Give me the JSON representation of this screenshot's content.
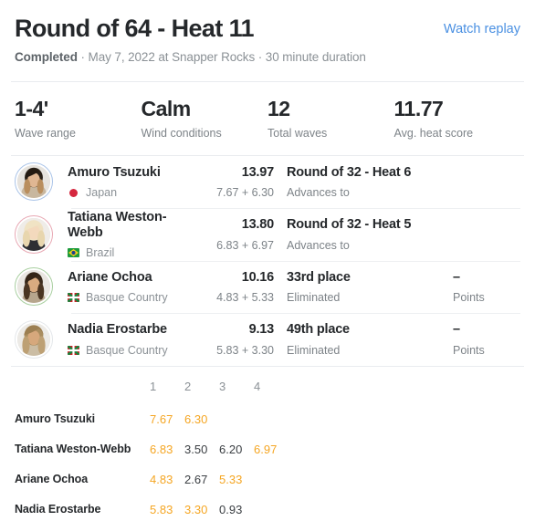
{
  "header": {
    "title": "Round of 64 - Heat 11",
    "watch_replay_label": "Watch replay",
    "status": "Completed",
    "subtitle_rest": " · May 7, 2022 at Snapper Rocks · 30 minute duration"
  },
  "stats": [
    {
      "value": "1-4'",
      "label": "Wave range"
    },
    {
      "value": "Calm",
      "label": "Wind conditions"
    },
    {
      "value": "12",
      "label": "Total waves"
    },
    {
      "value": "11.77",
      "label": "Avg. heat score"
    }
  ],
  "athletes": [
    {
      "name": "Amuro Tsuzuki",
      "country": "Japan",
      "flag": "japan-flag-icon",
      "ring_color": "#aac4e8",
      "total": "13.97",
      "breakdown": "7.67 + 6.30",
      "outcome": "Round of 32 - Heat 6",
      "outcome_sub": "Advances to",
      "points": "",
      "points_label": ""
    },
    {
      "name": "Tatiana Weston-Webb",
      "country": "Brazil",
      "flag": "brazil-flag-icon",
      "ring_color": "#e8a9b4",
      "total": "13.80",
      "breakdown": "6.83 + 6.97",
      "outcome": "Round of 32 - Heat 5",
      "outcome_sub": "Advances to",
      "points": "",
      "points_label": ""
    },
    {
      "name": "Ariane Ochoa",
      "country": "Basque Country",
      "flag": "basque-flag-icon",
      "ring_color": "#a9cfa0",
      "total": "10.16",
      "breakdown": "4.83 + 5.33",
      "outcome": "33rd place",
      "outcome_sub": "Eliminated",
      "points": "–",
      "points_label": "Points"
    },
    {
      "name": "Nadia Erostarbe",
      "country": "Basque Country",
      "flag": "basque-flag-icon",
      "ring_color": "#e4e7ea",
      "total": "9.13",
      "breakdown": "5.83 + 3.30",
      "outcome": "49th place",
      "outcome_sub": "Eliminated",
      "points": "–",
      "points_label": "Points"
    }
  ],
  "wave_table": {
    "columns": [
      "1",
      "2",
      "3",
      "4"
    ],
    "rows": [
      {
        "name": "Amuro Tsuzuki",
        "scores": [
          {
            "value": "7.67",
            "counted": true
          },
          {
            "value": "6.30",
            "counted": true
          },
          {
            "value": "",
            "counted": false
          },
          {
            "value": "",
            "counted": false
          }
        ]
      },
      {
        "name": "Tatiana Weston-Webb",
        "scores": [
          {
            "value": "6.83",
            "counted": true
          },
          {
            "value": "3.50",
            "counted": false
          },
          {
            "value": "6.20",
            "counted": false
          },
          {
            "value": "6.97",
            "counted": true
          }
        ]
      },
      {
        "name": "Ariane Ochoa",
        "scores": [
          {
            "value": "4.83",
            "counted": true
          },
          {
            "value": "2.67",
            "counted": false
          },
          {
            "value": "5.33",
            "counted": true
          },
          {
            "value": "",
            "counted": false
          }
        ]
      },
      {
        "name": "Nadia Erostarbe",
        "scores": [
          {
            "value": "5.83",
            "counted": true
          },
          {
            "value": "3.30",
            "counted": true
          },
          {
            "value": "0.93",
            "counted": false
          },
          {
            "value": "",
            "counted": false
          }
        ]
      }
    ]
  },
  "colors": {
    "accent_orange": "#f5a623",
    "link_blue": "#4a90e2",
    "text_dark": "#25282b",
    "text_muted": "#8b9196"
  }
}
